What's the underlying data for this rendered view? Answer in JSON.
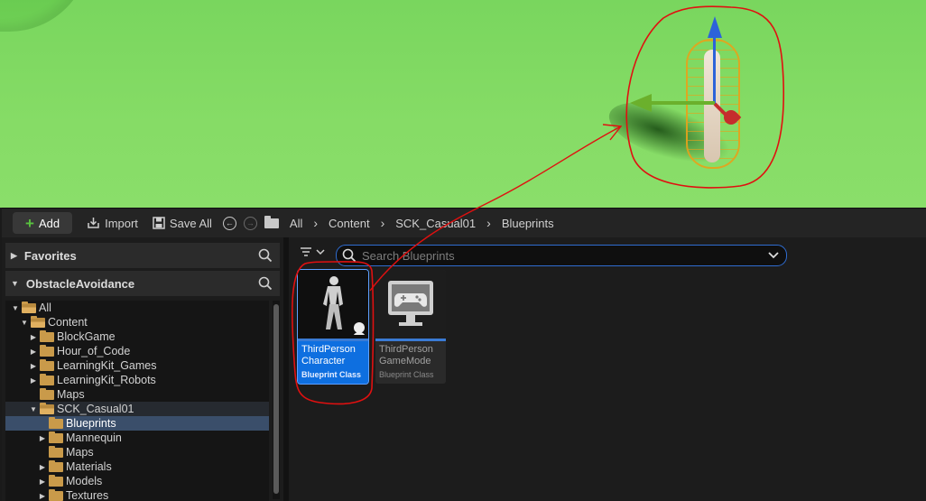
{
  "toolbar": {
    "add_label": "Add",
    "import_label": "Import",
    "save_all_label": "Save All",
    "breadcrumb": [
      "All",
      "Content",
      "SCK_Casual01",
      "Blueprints"
    ]
  },
  "left_panel": {
    "favorites_label": "Favorites",
    "project_label": "ObstacleAvoidance",
    "tree": [
      {
        "label": "All",
        "depth": 0,
        "expanded": true
      },
      {
        "label": "Content",
        "depth": 1,
        "expanded": true
      },
      {
        "label": "BlockGame",
        "depth": 2,
        "expanded": false
      },
      {
        "label": "Hour_of_Code",
        "depth": 2,
        "expanded": false
      },
      {
        "label": "LearningKit_Games",
        "depth": 2,
        "expanded": false
      },
      {
        "label": "LearningKit_Robots",
        "depth": 2,
        "expanded": false
      },
      {
        "label": "Maps",
        "depth": 2,
        "expanded": null
      },
      {
        "label": "SCK_Casual01",
        "depth": 2,
        "expanded": true
      },
      {
        "label": "Blueprints",
        "depth": 3,
        "expanded": null,
        "selected": true
      },
      {
        "label": "Mannequin",
        "depth": 3,
        "expanded": false
      },
      {
        "label": "Maps",
        "depth": 3,
        "expanded": null
      },
      {
        "label": "Materials",
        "depth": 3,
        "expanded": false
      },
      {
        "label": "Models",
        "depth": 3,
        "expanded": false
      },
      {
        "label": "Textures",
        "depth": 3,
        "expanded": false
      }
    ]
  },
  "content": {
    "search_placeholder": "Search Blueprints",
    "assets": [
      {
        "name_line1": "ThirdPerson",
        "name_line2": "Character",
        "class": "Blueprint Class",
        "icon": "mannequin-thumbnail",
        "selected": true
      },
      {
        "name_line1": "ThirdPerson",
        "name_line2": "GameMode",
        "class": "Blueprint Class",
        "icon": "gamepad-monitor-icon",
        "selected": false
      }
    ]
  },
  "colors": {
    "accent": "#0e6fe0",
    "add_plus": "#59c13f",
    "folder": "#c99a4a",
    "annotation": "#e01010",
    "viewport_grass": "#86dc66"
  }
}
